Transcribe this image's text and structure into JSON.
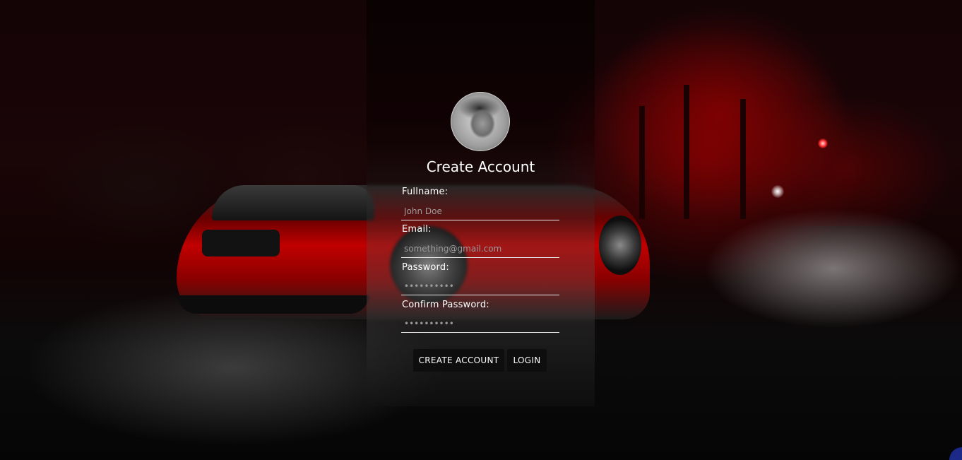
{
  "form": {
    "title": "Create Account",
    "fullname": {
      "label": "Fullname:",
      "placeholder": "John Doe",
      "value": ""
    },
    "email": {
      "label": "Email:",
      "placeholder": "something@gmail.com",
      "value": ""
    },
    "password": {
      "label": "Password:",
      "placeholder": "••••••••••",
      "value": ""
    },
    "confirm_password": {
      "label": "Confirm Password:",
      "placeholder": "••••••••••",
      "value": ""
    },
    "create_button_label": "CREATE ACCOUNT",
    "login_button_label": "LOGIN"
  },
  "avatar": {
    "icon": "user-avatar-photo"
  },
  "background": {
    "scene": "red-sports-car-night-street",
    "accent_color": "#c10000"
  }
}
